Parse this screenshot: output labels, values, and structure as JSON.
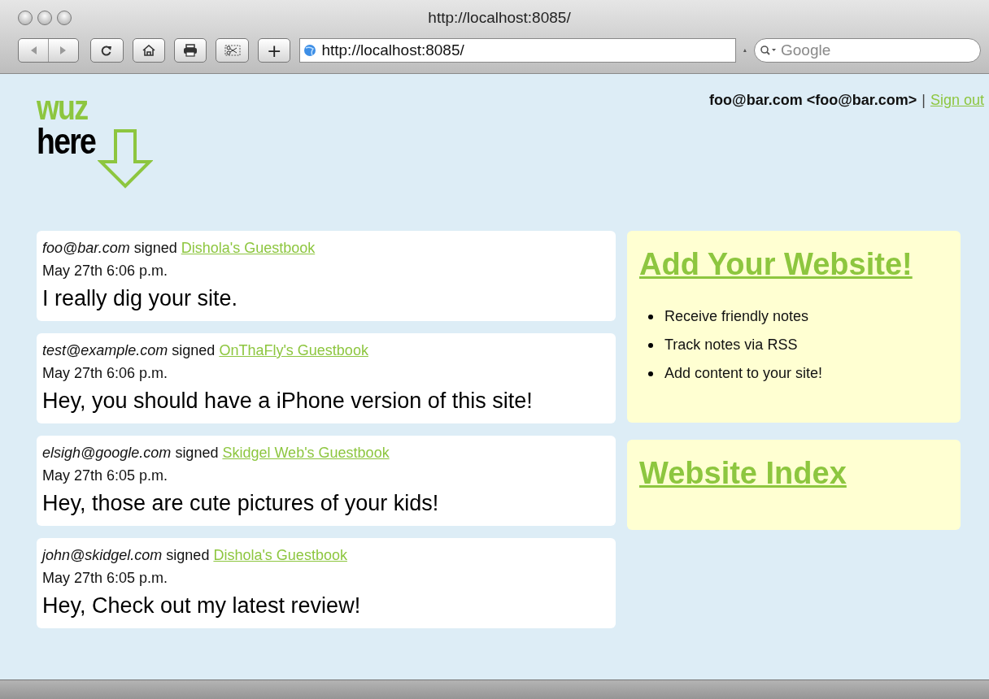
{
  "window": {
    "title": "http://localhost:8085/"
  },
  "toolbar": {
    "address": "http://localhost:8085/",
    "search": {
      "placeholder": "Google"
    },
    "add_button": "+"
  },
  "logo": {
    "top": "wuz",
    "bottom": "here"
  },
  "user_bar": {
    "user": "foo@bar.com <foo@bar.com>",
    "separator": "|",
    "sign_out": "Sign out"
  },
  "entries": [
    {
      "author": "foo@bar.com",
      "verb": "signed",
      "guestbook": "Dishola's Guestbook",
      "time": "May 27th 6:06 p.m.",
      "message": "I really dig your site."
    },
    {
      "author": "test@example.com",
      "verb": "signed",
      "guestbook": "OnThaFly's Guestbook",
      "time": "May 27th 6:06 p.m.",
      "message": "Hey, you should have a iPhone version of this site!"
    },
    {
      "author": "elsigh@google.com",
      "verb": "signed",
      "guestbook": "Skidgel Web's Guestbook",
      "time": "May 27th 6:05 p.m.",
      "message": "Hey, those are cute pictures of your kids!"
    },
    {
      "author": "john@skidgel.com",
      "verb": "signed",
      "guestbook": "Dishola's Guestbook",
      "time": "May 27th 6:05 p.m.",
      "message": "Hey, Check out my latest review!"
    }
  ],
  "sidebar": [
    {
      "title": "Add Your Website!",
      "items": [
        "Receive friendly notes",
        "Track notes via RSS",
        "Add content to your site!"
      ]
    },
    {
      "title": "Website Index"
    }
  ]
}
